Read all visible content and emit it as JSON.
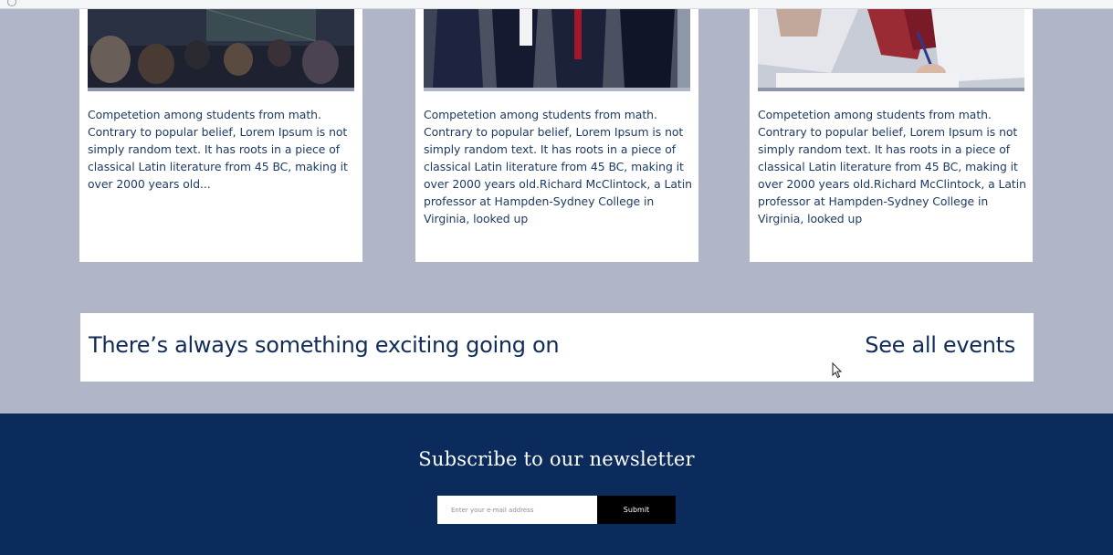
{
  "cards": [
    {
      "text": "Competetion among students from math. Contrary to popular belief, Lorem Ipsum is not simply random text. It has roots in a piece of classical Latin literature from 45 BC, making it over 2000 years old..."
    },
    {
      "text": "Competetion among students from math. Contrary to popular belief, Lorem Ipsum is not simply random text. It has roots in a piece of classical Latin literature from 45 BC, making it over 2000 years old.Richard McClintock, a Latin professor at Hampden-Sydney College in Virginia, looked up"
    },
    {
      "text": "Competetion among students from math. Contrary to popular belief, Lorem Ipsum is not simply random text. It has roots in a piece of classical Latin literature from 45 BC, making it over 2000 years old.Richard McClintock, a Latin professor at Hampden-Sydney College in Virginia, looked up"
    }
  ],
  "events": {
    "title": "There’s always something exciting going on",
    "link_label": "See all events"
  },
  "newsletter": {
    "heading": "Subscribe to our newsletter",
    "email_placeholder": "Enter your e-mail address",
    "submit_label": "Submit"
  },
  "social_icons": [
    "instagram-icon",
    "facebook-icon",
    "linkedin-icon",
    "youtube-icon"
  ],
  "colors": {
    "page_background": "#b0b6c7",
    "footer_background": "#0a2b5c",
    "text_navy": "#102c57",
    "submit_background": "#000000"
  }
}
